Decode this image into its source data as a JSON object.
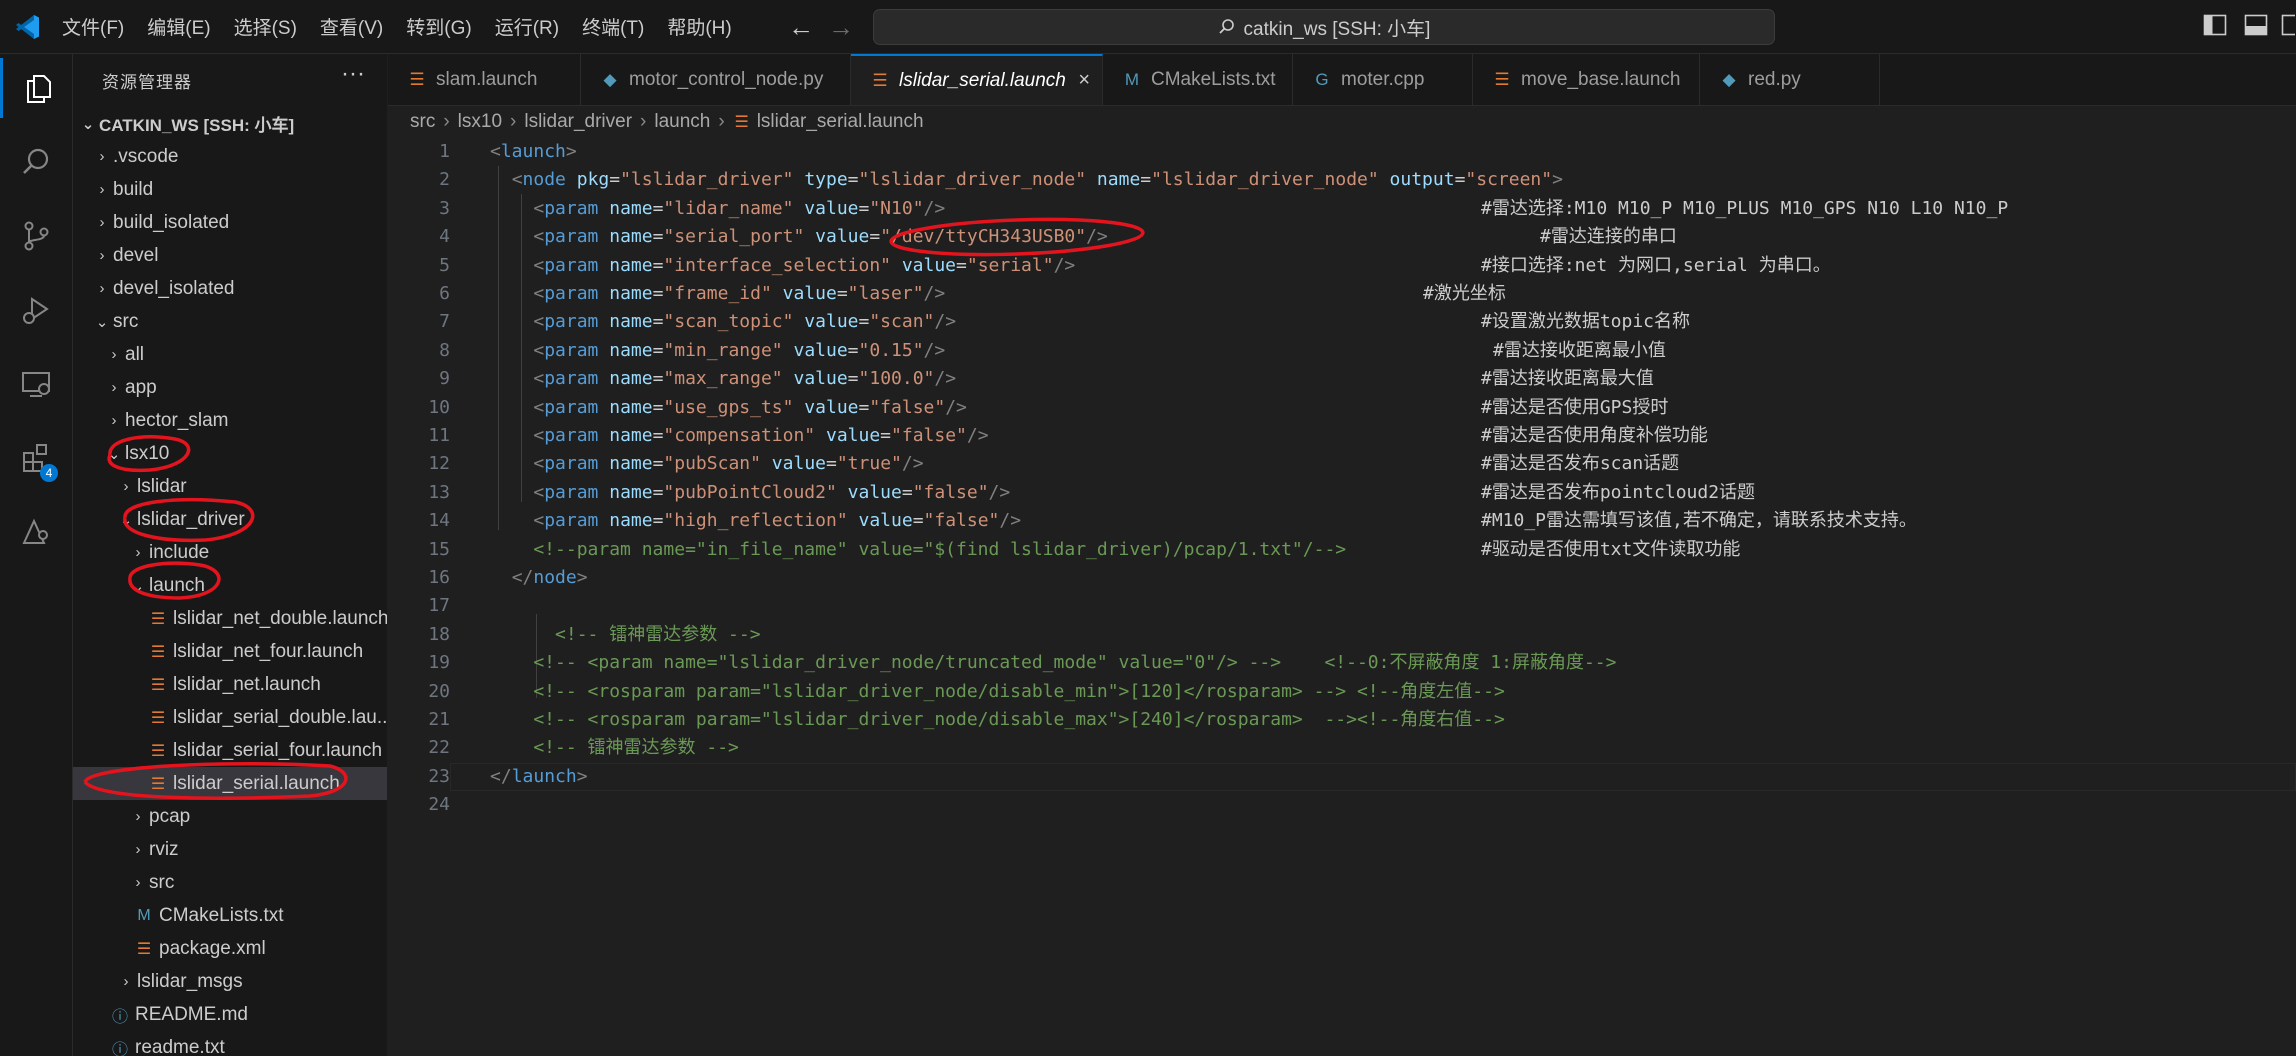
{
  "menu": [
    "文件(F)",
    "编辑(E)",
    "选择(S)",
    "查看(V)",
    "转到(G)",
    "运行(R)",
    "终端(T)",
    "帮助(H)"
  ],
  "command_center": "catkin_ws [SSH: 小车]",
  "explorer": {
    "title": "资源管理器",
    "root": "CATKIN_WS [SSH: 小车]",
    "extensions_badge": "4",
    "items": [
      {
        "label": ".vscode",
        "type": "folder",
        "twisty": "›"
      },
      {
        "label": "build",
        "type": "folder",
        "twisty": "›"
      },
      {
        "label": "build_isolated",
        "type": "folder",
        "twisty": "›"
      },
      {
        "label": "devel",
        "type": "folder",
        "twisty": "›"
      },
      {
        "label": "devel_isolated",
        "type": "folder",
        "twisty": "›"
      },
      {
        "label": "src",
        "type": "folder",
        "twisty": "⌄"
      },
      {
        "label": "all",
        "type": "folder",
        "twisty": "›"
      },
      {
        "label": "app",
        "type": "folder",
        "twisty": "›"
      },
      {
        "label": "hector_slam",
        "type": "folder",
        "twisty": "›"
      },
      {
        "label": "lsx10",
        "type": "folder",
        "twisty": "⌄"
      },
      {
        "label": "lslidar",
        "type": "folder",
        "twisty": "›"
      },
      {
        "label": "lslidar_driver",
        "type": "folder",
        "twisty": "⌄"
      },
      {
        "label": "include",
        "type": "folder",
        "twisty": "›"
      },
      {
        "label": "launch",
        "type": "folder",
        "twisty": "⌄"
      },
      {
        "label": "lslidar_net_double.launch",
        "type": "rss"
      },
      {
        "label": "lslidar_net_four.launch",
        "type": "rss"
      },
      {
        "label": "lslidar_net.launch",
        "type": "rss"
      },
      {
        "label": "lslidar_serial_double.lau...",
        "type": "rss"
      },
      {
        "label": "lslidar_serial_four.launch",
        "type": "rss"
      },
      {
        "label": "lslidar_serial.launch",
        "type": "rss"
      },
      {
        "label": "pcap",
        "type": "folder",
        "twisty": "›"
      },
      {
        "label": "rviz",
        "type": "folder",
        "twisty": "›"
      },
      {
        "label": "src",
        "type": "folder",
        "twisty": "›"
      },
      {
        "label": "CMakeLists.txt",
        "type": "cmake"
      },
      {
        "label": "package.xml",
        "type": "rss"
      },
      {
        "label": "lslidar_msgs",
        "type": "folder",
        "twisty": "›"
      },
      {
        "label": "README.md",
        "type": "info"
      },
      {
        "label": "readme.txt",
        "type": "info"
      }
    ]
  },
  "tabs": [
    {
      "label": "slam.launch",
      "type": "rss"
    },
    {
      "label": "motor_control_node.py",
      "type": "py"
    },
    {
      "label": "lslidar_serial.launch",
      "type": "rss",
      "close": "×"
    },
    {
      "label": "CMakeLists.txt",
      "type": "cmake"
    },
    {
      "label": "moter.cpp",
      "type": "cpp"
    },
    {
      "label": "move_base.launch",
      "type": "rss"
    },
    {
      "label": "red.py",
      "type": "py"
    }
  ],
  "breadcrumb": [
    "src",
    "lsx10",
    "lslidar_driver",
    "launch",
    "lslidar_serial.launch"
  ],
  "code": [
    {
      "n": "1",
      "segs": [
        [
          "pn",
          "<"
        ],
        [
          "tg",
          "launch"
        ],
        [
          "pn",
          ">"
        ]
      ]
    },
    {
      "n": "2",
      "segs": [
        [
          "",
          "  "
        ],
        [
          "pn",
          "<"
        ],
        [
          "tg",
          "node"
        ],
        [
          "",
          ""
        ],
        [
          "at",
          " pkg"
        ],
        [
          "",
          "="
        ],
        [
          "st",
          "\"lslidar_driver\""
        ],
        [
          "at",
          " type"
        ],
        [
          "",
          "="
        ],
        [
          "st",
          "\"lslidar_driver_node\""
        ],
        [
          "at",
          " name"
        ],
        [
          "",
          "="
        ],
        [
          "st",
          "\"lslidar_driver_node\""
        ],
        [
          "at",
          " output"
        ],
        [
          "",
          "="
        ],
        [
          "st",
          "\"screen\""
        ],
        [
          "pn",
          ">"
        ]
      ]
    },
    {
      "n": "3",
      "segs": [
        [
          "",
          "    "
        ],
        [
          "pn",
          "<"
        ],
        [
          "tg",
          "param"
        ],
        [
          "at",
          " name"
        ],
        [
          "",
          "="
        ],
        [
          "st",
          "\"lidar_name\""
        ],
        [
          "at",
          " value"
        ],
        [
          "",
          "="
        ],
        [
          "st",
          "\"N10\""
        ],
        [
          "pn",
          "/>"
        ]
      ],
      "comment": "#雷达选择:M10 M10_P M10_PLUS M10_GPS N10 L10 N10_P"
    },
    {
      "n": "4",
      "segs": [
        [
          "",
          "    "
        ],
        [
          "pn",
          "<"
        ],
        [
          "tg",
          "param"
        ],
        [
          "at",
          " name"
        ],
        [
          "",
          "="
        ],
        [
          "st",
          "\"serial_port\""
        ],
        [
          "at",
          " value"
        ],
        [
          "",
          "="
        ],
        [
          "st",
          "\"/dev/ttyCH343USB0\""
        ],
        [
          "pn",
          "/>"
        ]
      ],
      "comment": "#雷达连接的串口"
    },
    {
      "n": "5",
      "segs": [
        [
          "",
          "    "
        ],
        [
          "pn",
          "<"
        ],
        [
          "tg",
          "param"
        ],
        [
          "at",
          " name"
        ],
        [
          "",
          "="
        ],
        [
          "st",
          "\"interface_selection\""
        ],
        [
          "at",
          " value"
        ],
        [
          "",
          "="
        ],
        [
          "st",
          "\"serial\""
        ],
        [
          "pn",
          "/>"
        ]
      ],
      "comment": "#接口选择:net 为网口,serial 为串口。"
    },
    {
      "n": "6",
      "segs": [
        [
          "",
          "    "
        ],
        [
          "pn",
          "<"
        ],
        [
          "tg",
          "param"
        ],
        [
          "at",
          " name"
        ],
        [
          "",
          "="
        ],
        [
          "st",
          "\"frame_id\""
        ],
        [
          "at",
          " value"
        ],
        [
          "",
          "="
        ],
        [
          "st",
          "\"laser\""
        ],
        [
          "pn",
          "/>"
        ]
      ],
      "comment": "#激光坐标"
    },
    {
      "n": "7",
      "segs": [
        [
          "",
          "    "
        ],
        [
          "pn",
          "<"
        ],
        [
          "tg",
          "param"
        ],
        [
          "at",
          " name"
        ],
        [
          "",
          "="
        ],
        [
          "st",
          "\"scan_topic\""
        ],
        [
          "at",
          " value"
        ],
        [
          "",
          "="
        ],
        [
          "st",
          "\"scan\""
        ],
        [
          "pn",
          "/>"
        ]
      ],
      "comment": "#设置激光数据topic名称"
    },
    {
      "n": "8",
      "segs": [
        [
          "",
          "    "
        ],
        [
          "pn",
          "<"
        ],
        [
          "tg",
          "param"
        ],
        [
          "at",
          " name"
        ],
        [
          "",
          "="
        ],
        [
          "st",
          "\"min_range\""
        ],
        [
          "at",
          " value"
        ],
        [
          "",
          "="
        ],
        [
          "st",
          "\"0.15\""
        ],
        [
          "pn",
          "/>"
        ]
      ],
      "comment": "#雷达接收距离最小值"
    },
    {
      "n": "9",
      "segs": [
        [
          "",
          "    "
        ],
        [
          "pn",
          "<"
        ],
        [
          "tg",
          "param"
        ],
        [
          "at",
          " name"
        ],
        [
          "",
          "="
        ],
        [
          "st",
          "\"max_range\""
        ],
        [
          "at",
          " value"
        ],
        [
          "",
          "="
        ],
        [
          "st",
          "\"100.0\""
        ],
        [
          "pn",
          "/>"
        ]
      ],
      "comment": "#雷达接收距离最大值"
    },
    {
      "n": "10",
      "segs": [
        [
          "",
          "    "
        ],
        [
          "pn",
          "<"
        ],
        [
          "tg",
          "param"
        ],
        [
          "at",
          " name"
        ],
        [
          "",
          "="
        ],
        [
          "st",
          "\"use_gps_ts\""
        ],
        [
          "at",
          " value"
        ],
        [
          "",
          "="
        ],
        [
          "st",
          "\"false\""
        ],
        [
          "pn",
          "/>"
        ]
      ],
      "comment": "#雷达是否使用GPS授时"
    },
    {
      "n": "11",
      "segs": [
        [
          "",
          "    "
        ],
        [
          "pn",
          "<"
        ],
        [
          "tg",
          "param"
        ],
        [
          "at",
          " name"
        ],
        [
          "",
          "="
        ],
        [
          "st",
          "\"compensation\""
        ],
        [
          "at",
          " value"
        ],
        [
          "",
          "="
        ],
        [
          "st",
          "\"false\""
        ],
        [
          "pn",
          "/>"
        ]
      ],
      "comment": "#雷达是否使用角度补偿功能"
    },
    {
      "n": "12",
      "segs": [
        [
          "",
          "    "
        ],
        [
          "pn",
          "<"
        ],
        [
          "tg",
          "param"
        ],
        [
          "at",
          " name"
        ],
        [
          "",
          "="
        ],
        [
          "st",
          "\"pubScan\""
        ],
        [
          "at",
          " value"
        ],
        [
          "",
          "="
        ],
        [
          "st",
          "\"true\""
        ],
        [
          "pn",
          "/>"
        ]
      ],
      "comment": "#雷达是否发布scan话题"
    },
    {
      "n": "13",
      "segs": [
        [
          "",
          "    "
        ],
        [
          "pn",
          "<"
        ],
        [
          "tg",
          "param"
        ],
        [
          "at",
          " name"
        ],
        [
          "",
          "="
        ],
        [
          "st",
          "\"pubPointCloud2\""
        ],
        [
          "at",
          " value"
        ],
        [
          "",
          "="
        ],
        [
          "st",
          "\"false\""
        ],
        [
          "pn",
          "/>"
        ]
      ],
      "comment": "#雷达是否发布pointcloud2话题"
    },
    {
      "n": "14",
      "segs": [
        [
          "",
          "    "
        ],
        [
          "pn",
          "<"
        ],
        [
          "tg",
          "param"
        ],
        [
          "at",
          " name"
        ],
        [
          "",
          "="
        ],
        [
          "st",
          "\"high_reflection\""
        ],
        [
          "at",
          " value"
        ],
        [
          "",
          "="
        ],
        [
          "st",
          "\"false\""
        ],
        [
          "pn",
          "/>"
        ]
      ],
      "comment": "#M10_P雷达需填写该值,若不确定，请联系技术支持。"
    },
    {
      "n": "15",
      "segs": [
        [
          "gc",
          "    <!--param name=\"in_file_name\" value=\"$(find lslidar_driver)/pcap/1.txt\"/-->"
        ]
      ],
      "comment": "#驱动是否使用txt文件读取功能"
    },
    {
      "n": "16",
      "segs": [
        [
          "",
          "  "
        ],
        [
          "pn",
          "</"
        ],
        [
          "tg",
          "node"
        ],
        [
          "pn",
          ">"
        ]
      ]
    },
    {
      "n": "17",
      "segs": []
    },
    {
      "n": "18",
      "segs": [
        [
          "gc",
          "      <!-- 镭神雷达参数 -->"
        ]
      ]
    },
    {
      "n": "19",
      "segs": [
        [
          "gc",
          "    <!-- <param name=\"lslidar_driver_node/truncated_mode\" value=\"0\"/> -->    <!--0:不屏蔽角度 1:屏蔽角度-->"
        ]
      ]
    },
    {
      "n": "20",
      "segs": [
        [
          "gc",
          "    <!-- <rosparam param=\"lslidar_driver_node/disable_min\">[120]</rosparam> --> <!--角度左值-->"
        ]
      ]
    },
    {
      "n": "21",
      "segs": [
        [
          "gc",
          "    <!-- <rosparam param=\"lslidar_driver_node/disable_max\">[240]</rosparam>  --><!--角度右值-->"
        ]
      ]
    },
    {
      "n": "22",
      "segs": [
        [
          "gc",
          "    <!-- 镭神雷达参数 -->"
        ]
      ]
    },
    {
      "n": "23",
      "segs": [
        [
          "pn",
          "</"
        ],
        [
          "tg",
          "launch"
        ],
        [
          "pn",
          ">"
        ]
      ]
    },
    {
      "n": "24",
      "segs": []
    }
  ]
}
